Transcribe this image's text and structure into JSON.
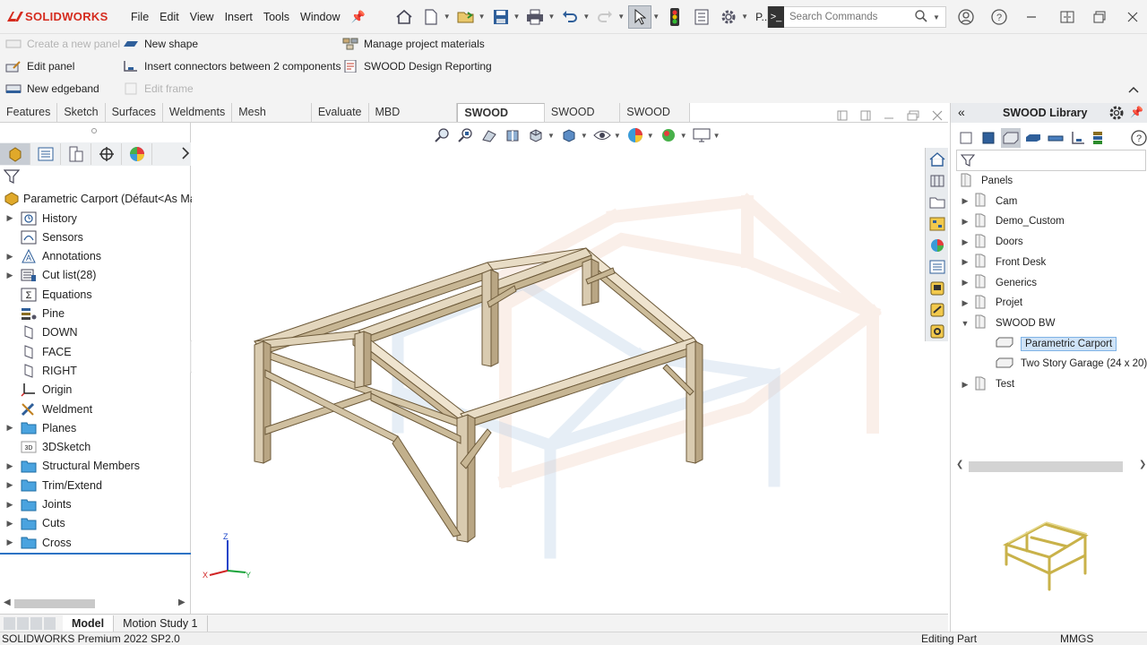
{
  "app": {
    "logo_text": "SOLIDWORKS",
    "menu": [
      "File",
      "Edit",
      "View",
      "Insert",
      "Tools",
      "Window"
    ],
    "search_placeholder": "Search Commands",
    "toolbar_extra_label": "P..."
  },
  "commands": {
    "create_panel": "Create a new panel",
    "edit_panel": "Edit panel",
    "new_edgeband": "New edgeband",
    "new_shape": "New shape",
    "insert_connectors": "Insert connectors between 2 components",
    "edit_frame": "Edit frame",
    "manage_materials": "Manage project materials",
    "design_reporting": "SWOOD Design Reporting"
  },
  "tabs": [
    "Features",
    "Sketch",
    "Surfaces",
    "Weldments",
    "Mesh Modeling",
    "Evaluate",
    "MBD Dimensions",
    "SWOOD Design",
    "SWOOD CAM",
    "SWOOD BW"
  ],
  "active_tab": "SWOOD Design",
  "feature_tree": {
    "root": "Parametric Carport (Défaut<As Mac",
    "items": [
      {
        "label": "History",
        "expand": true,
        "icon": "history-icon"
      },
      {
        "label": "Sensors",
        "expand": false,
        "icon": "sensor-icon"
      },
      {
        "label": "Annotations",
        "expand": true,
        "icon": "annotation-icon"
      },
      {
        "label": "Cut list(28)",
        "expand": true,
        "icon": "cutlist-icon"
      },
      {
        "label": "Equations",
        "expand": false,
        "icon": "equation-icon"
      },
      {
        "label": "Pine",
        "expand": false,
        "icon": "material-icon"
      },
      {
        "label": "DOWN",
        "expand": false,
        "icon": "plane-icon"
      },
      {
        "label": "FACE",
        "expand": false,
        "icon": "plane-icon"
      },
      {
        "label": "RIGHT",
        "expand": false,
        "icon": "plane-icon"
      },
      {
        "label": "Origin",
        "expand": false,
        "icon": "origin-icon"
      },
      {
        "label": "Weldment",
        "expand": false,
        "icon": "weldment-icon"
      },
      {
        "label": "Planes",
        "expand": true,
        "icon": "folder-icon"
      },
      {
        "label": "3DSketch",
        "expand": false,
        "icon": "sketch3d-icon"
      },
      {
        "label": "Structural Members",
        "expand": true,
        "icon": "folder-icon"
      },
      {
        "label": "Trim/Extend",
        "expand": true,
        "icon": "folder-icon"
      },
      {
        "label": "Joints",
        "expand": true,
        "icon": "folder-icon"
      },
      {
        "label": "Cuts",
        "expand": true,
        "icon": "folder-icon"
      },
      {
        "label": "Cross",
        "expand": true,
        "icon": "folder-icon"
      }
    ]
  },
  "library": {
    "title": "SWOOD Library",
    "items": [
      {
        "label": "Panels",
        "expand": "none",
        "level": 0
      },
      {
        "label": "Cam",
        "expand": "collapsed",
        "level": 1
      },
      {
        "label": "Demo_Custom",
        "expand": "collapsed",
        "level": 1
      },
      {
        "label": "Doors",
        "expand": "collapsed",
        "level": 1
      },
      {
        "label": "Front Desk",
        "expand": "collapsed",
        "level": 1
      },
      {
        "label": "Generics",
        "expand": "collapsed",
        "level": 1
      },
      {
        "label": "Projet",
        "expand": "collapsed",
        "level": 1
      },
      {
        "label": "SWOOD BW",
        "expand": "expanded",
        "level": 1
      },
      {
        "label": "Parametric Carport",
        "expand": "leaf",
        "level": 2,
        "selected": true
      },
      {
        "label": "Two Story Garage (24 x 20)",
        "expand": "leaf",
        "level": 2
      },
      {
        "label": "Test",
        "expand": "collapsed",
        "level": 1
      }
    ]
  },
  "bottom_tabs": [
    "Model",
    "Motion Study 1"
  ],
  "status": {
    "version": "SOLIDWORKS Premium 2022 SP2.0",
    "mode": "Editing Part",
    "units": "MMGS"
  },
  "colors": {
    "accent": "#d52b1e",
    "selection": "#cfe3f7",
    "wood": "#d9cbb0"
  }
}
